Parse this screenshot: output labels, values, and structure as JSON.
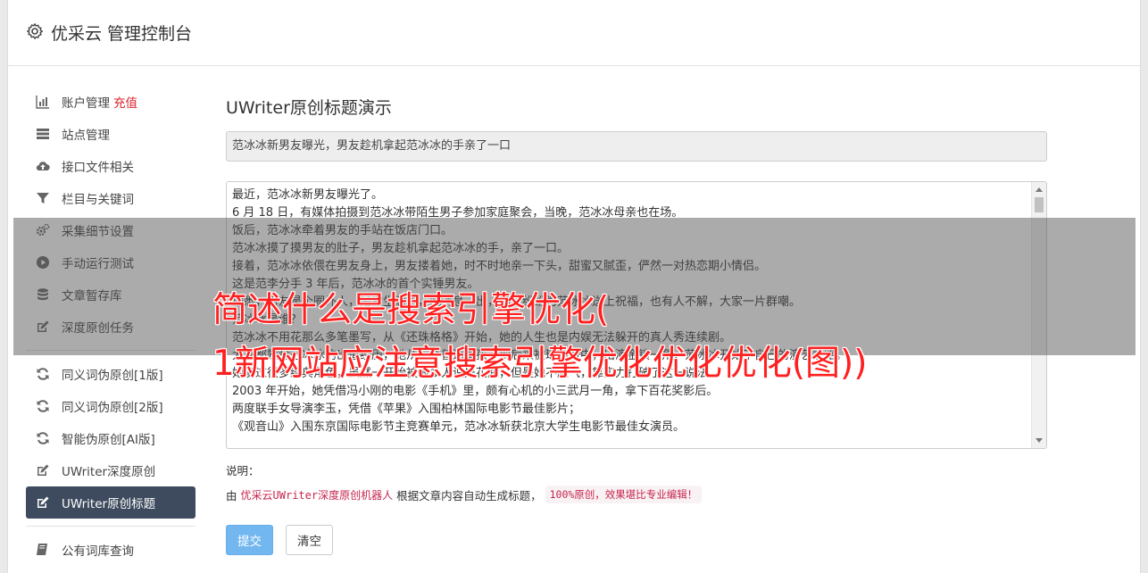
{
  "app": {
    "title": "优采云 管理控制台",
    "icon": "gear-icon"
  },
  "sidebar": {
    "groups": [
      [
        {
          "label": "账户管理",
          "badge": "充值",
          "icon": "bar-chart-icon"
        },
        {
          "label": "站点管理",
          "icon": "server-icon"
        },
        {
          "label": "接口文件相关",
          "icon": "cloud-upload-icon"
        },
        {
          "label": "栏目与关键词",
          "icon": "filter-icon"
        },
        {
          "label": "采集细节设置",
          "icon": "gears-icon"
        },
        {
          "label": "手动运行测试",
          "icon": "play-circle-icon"
        },
        {
          "label": "文章暂存库",
          "icon": "database-icon"
        },
        {
          "label": "深度原创任务",
          "icon": "edit-icon"
        }
      ],
      [
        {
          "label": "同义词伪原创[1版]",
          "icon": "refresh-icon"
        },
        {
          "label": "同义词伪原创[2版]",
          "icon": "refresh-icon"
        },
        {
          "label": "智能伪原创[AI版]",
          "icon": "refresh-icon"
        },
        {
          "label": "UWriter深度原创",
          "icon": "edit-icon"
        },
        {
          "label": "UWriter原创标题",
          "icon": "edit-icon",
          "active": true
        }
      ],
      [
        {
          "label": "公有词库查询",
          "icon": "book-icon"
        }
      ]
    ]
  },
  "main": {
    "heading": "UWriter原创标题演示",
    "title_value": "范冰冰新男友曝光，男友趁机拿起范冰冰的手亲了一口",
    "body_lines": [
      "最近，范冰冰新男友曝光了。",
      "6 月 18 日，有媒体拍摄到范冰冰带陌生男子参加家庭聚会，当晚，范冰冰母亲也在场。",
      "饭后，范冰冰牵着男友的手站在饭店门口。",
      "范冰冰摸了摸男友的肚子，男友趁机拿起范冰冰的手，亲了一口。",
      "接着，范冰冰依偎在男友身上，男友搂着她，时不时地亲一下头，甜蜜又腻歪，俨然一对热恋期小情侣。",
      "这是范李分手 3 年后，范冰冰的首个实锤男友。",
      "据悉，男友是个圈外人，是做生意的，此消息一出，网友纷纷为范冰冰送上祝福，也有人不解，大家一片群嘲。",
      "范冰冰是谁？",
      "范冰冰不用花那么多笔墨写，从《还珠格格》开始，她的人生也是内娱无法躲开的真人秀连续剧。",
      "大家都熟悉范冰冰的出道经历，她从一个普通女孩，到后来被琼瑶看中，出演金锁一角，范冰冰开始了自己的演艺之路。",
      "她演过很多经典角色，虽然一开始被很多人说是花瓶，但是她不服气，靠实力打破了这一说法。",
      "2003 年开始，她凭借冯小刚的电影《手机》里，颇有心机的小三武月一角，拿下百花奖影后。",
      "两度联手女导演李玉，凭借《苹果》入围柏林国际电影节最佳影片；",
      "《观音山》入围东京国际电影节主竞赛单元，范冰冰斩获北京大学生电影节最佳女演员。"
    ],
    "note_label": "说明：",
    "note_prefix": "由",
    "note_link": "优采云UWriter深度原创机器人",
    "note_middle": "根据文章内容自动生成标题，",
    "note_code": "100%原创，效果堪比专业编辑！",
    "submit_label": "提交",
    "clear_label": "清空"
  },
  "watermark": {
    "line1": "简述什么是搜索引擎优化(",
    "line2": "1新网站应注意搜索引擎优化优化优化(图))"
  },
  "colors": {
    "accent": "#73b7f0",
    "active_nav": "#3e4b5e",
    "badge": "#d9232d",
    "code": "#c7254e",
    "watermark": "#ff2020"
  }
}
